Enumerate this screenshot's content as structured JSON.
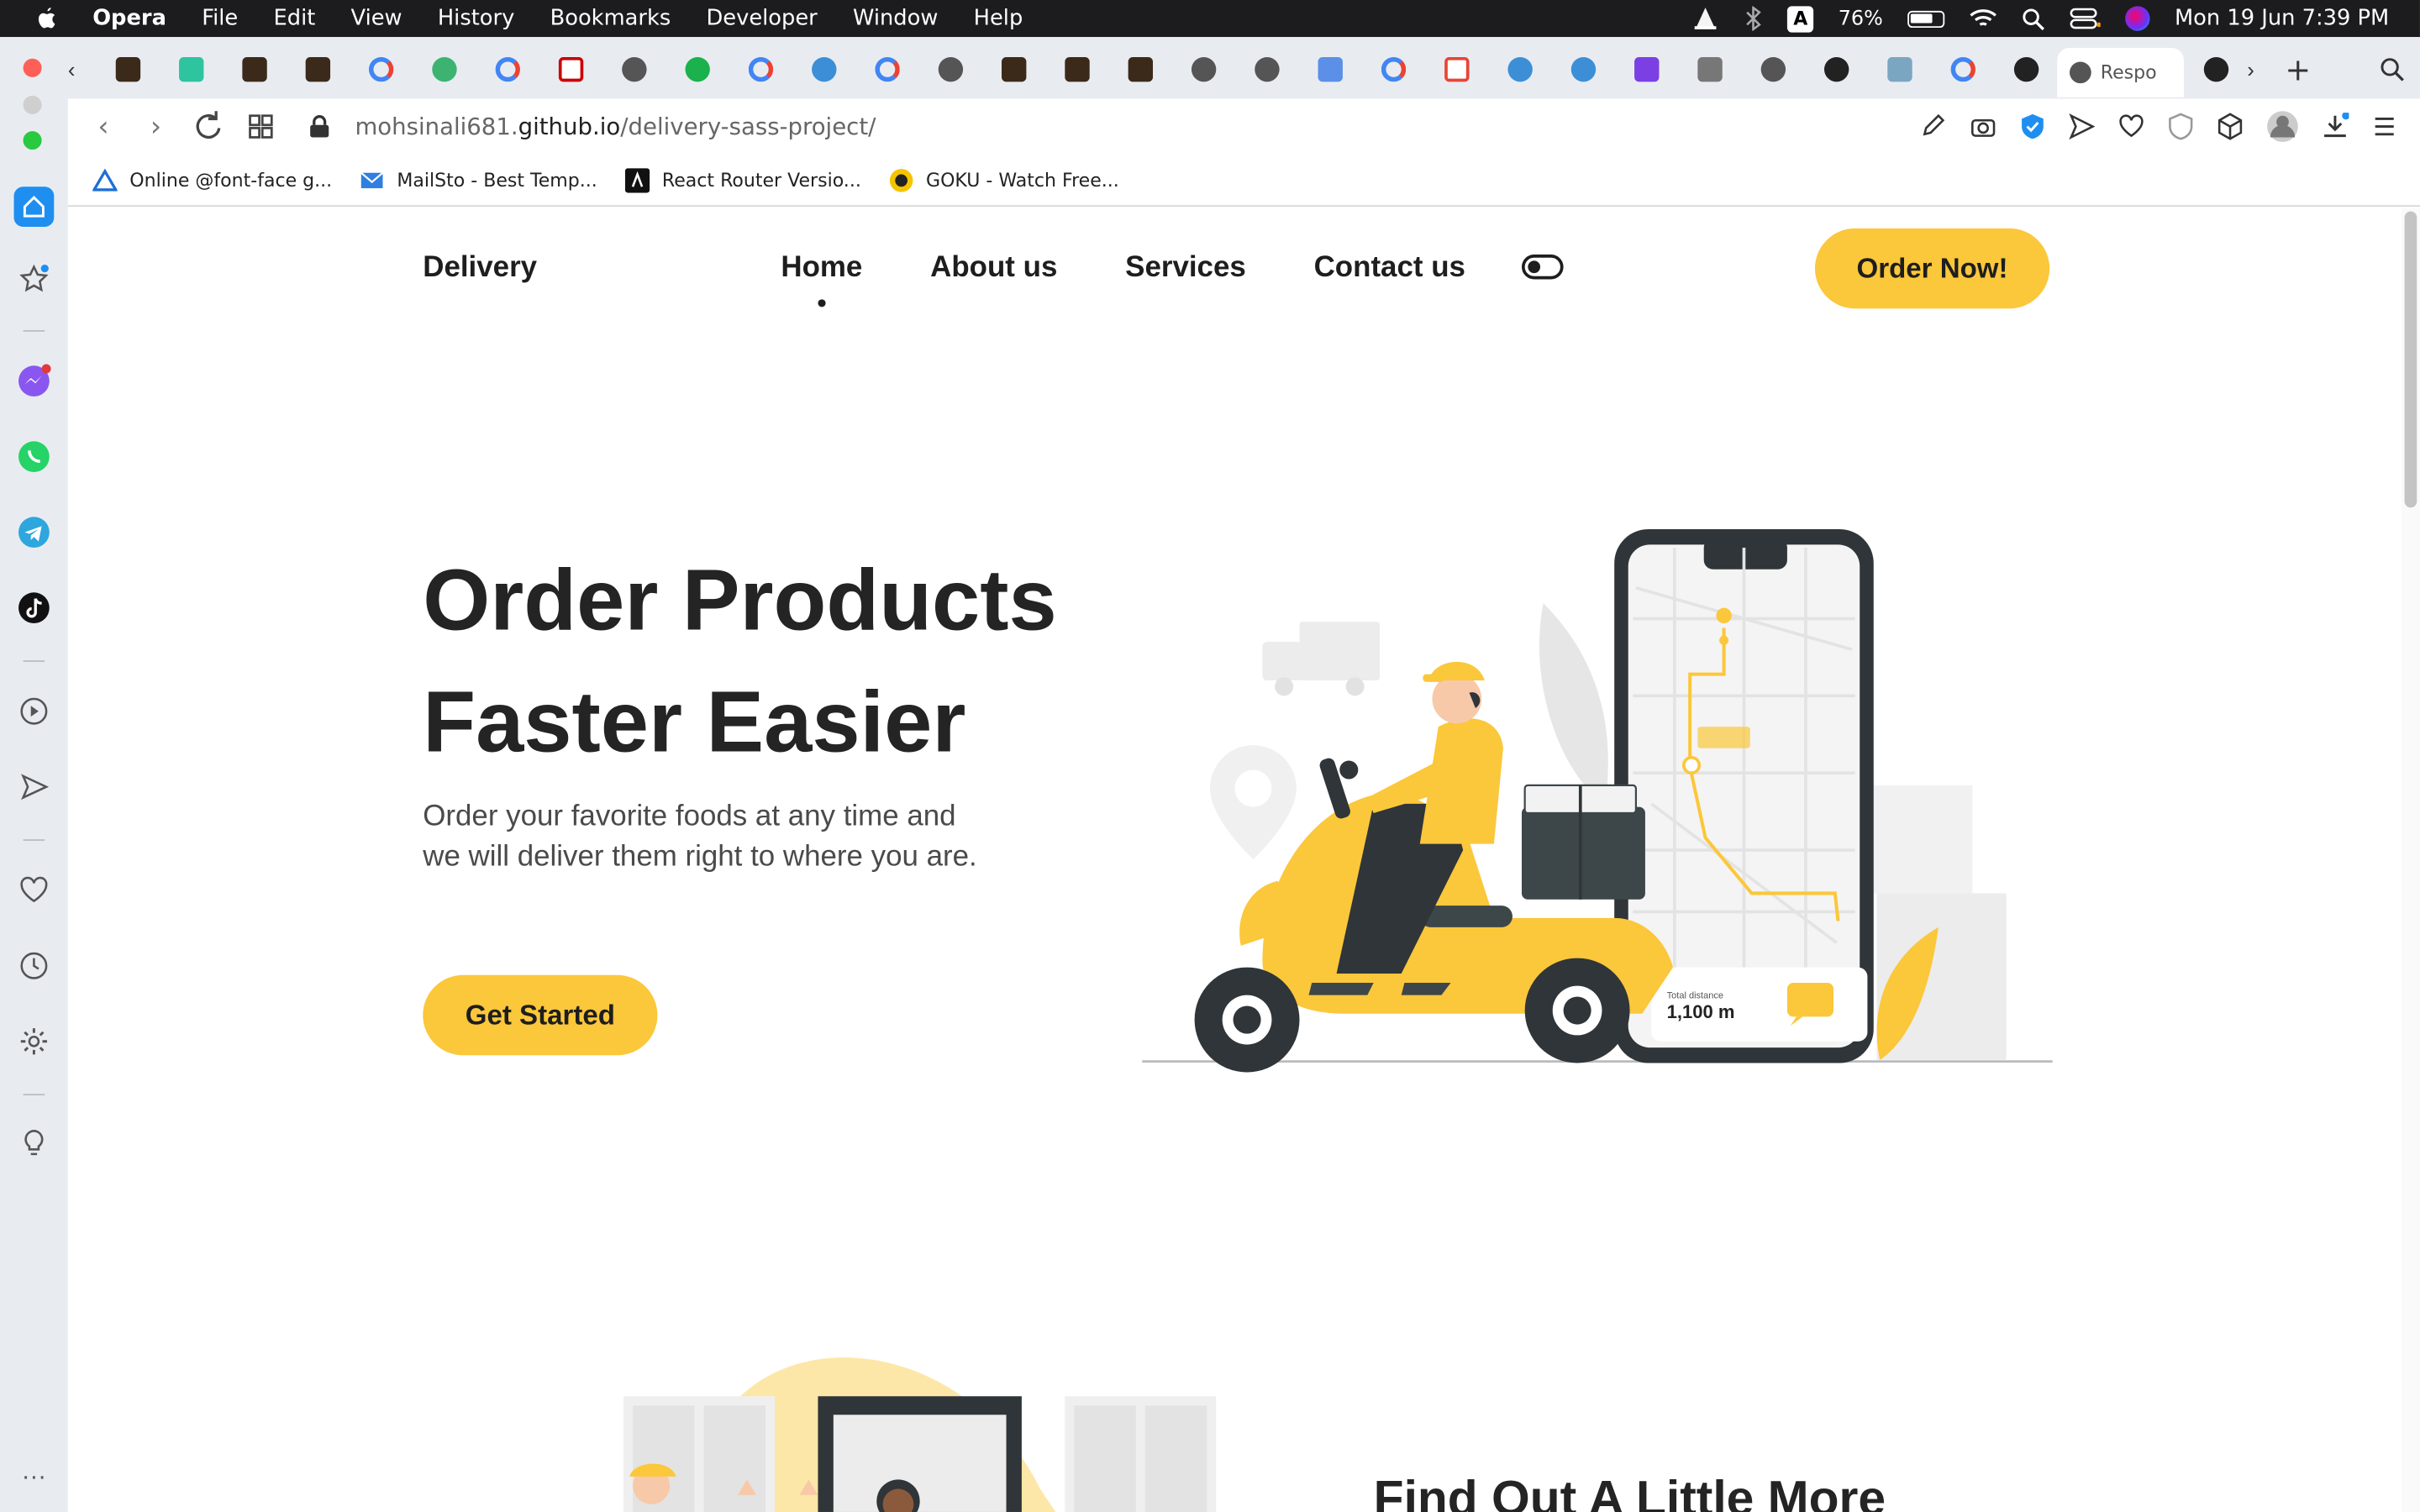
{
  "menubar": {
    "app": "Opera",
    "items": [
      "File",
      "Edit",
      "View",
      "History",
      "Bookmarks",
      "Developer",
      "Window",
      "Help"
    ],
    "battery": "76%",
    "clock": "Mon 19 Jun  7:39 PM"
  },
  "browser": {
    "active_tab_label": "Respo",
    "url_host_prefix": "mohsinali681.",
    "url_host_main": "github.io",
    "url_path": "/delivery-sass-project/",
    "bookmarks": [
      {
        "label": "Online @font-face g...",
        "icon": "triangle-icon"
      },
      {
        "label": "MailSto - Best Temp...",
        "icon": "mail-icon"
      },
      {
        "label": "React Router Versio...",
        "icon": "react-router-icon"
      },
      {
        "label": "GOKU - Watch Free...",
        "icon": "goku-icon"
      }
    ]
  },
  "site": {
    "brand": "Delivery",
    "nav": [
      "Home",
      "About us",
      "Services",
      "Contact us"
    ],
    "order_button": "Order Now!",
    "hero_title_line1": "Order Products",
    "hero_title_line2": "Faster Easier",
    "hero_subtitle": "Order your favorite foods at any time and we will deliver them right to where you are.",
    "cta": "Get Started",
    "illustration_distance_label": "Total distance",
    "illustration_distance_value": "1,100 m",
    "section2_title": "Find Out A Little More",
    "accent_color": "#fbc73b"
  }
}
